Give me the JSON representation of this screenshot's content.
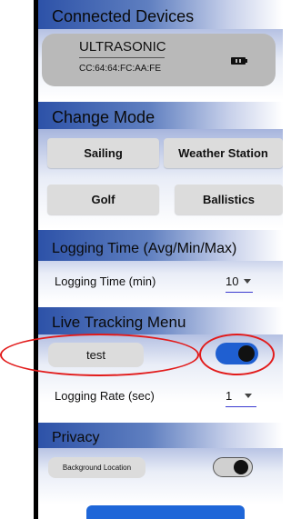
{
  "sections": {
    "connected_devices": "Connected Devices",
    "change_mode": "Change Mode",
    "logging_time": "Logging Time (Avg/Min/Max)",
    "live_tracking": "Live Tracking Menu",
    "privacy": "Privacy"
  },
  "device": {
    "name": "ULTRASONIC",
    "mac": "CC:64:64:FC:AA:FE",
    "icon": "battery-icon"
  },
  "modes": [
    "Sailing",
    "Weather Station",
    "Golf",
    "Ballistics"
  ],
  "logging_time": {
    "label": "Logging Time (min)",
    "value": "10"
  },
  "live_tracking": {
    "chip_label": "test",
    "toggle_on": true,
    "rate_label": "Logging Rate (sec)",
    "rate_value": "1"
  },
  "privacy": {
    "chip_label": "Background Location",
    "toggle_on": false
  },
  "colors": {
    "accent": "#1f5fd1",
    "annotation": "#e21b1b",
    "header_start": "#2d52a8"
  }
}
